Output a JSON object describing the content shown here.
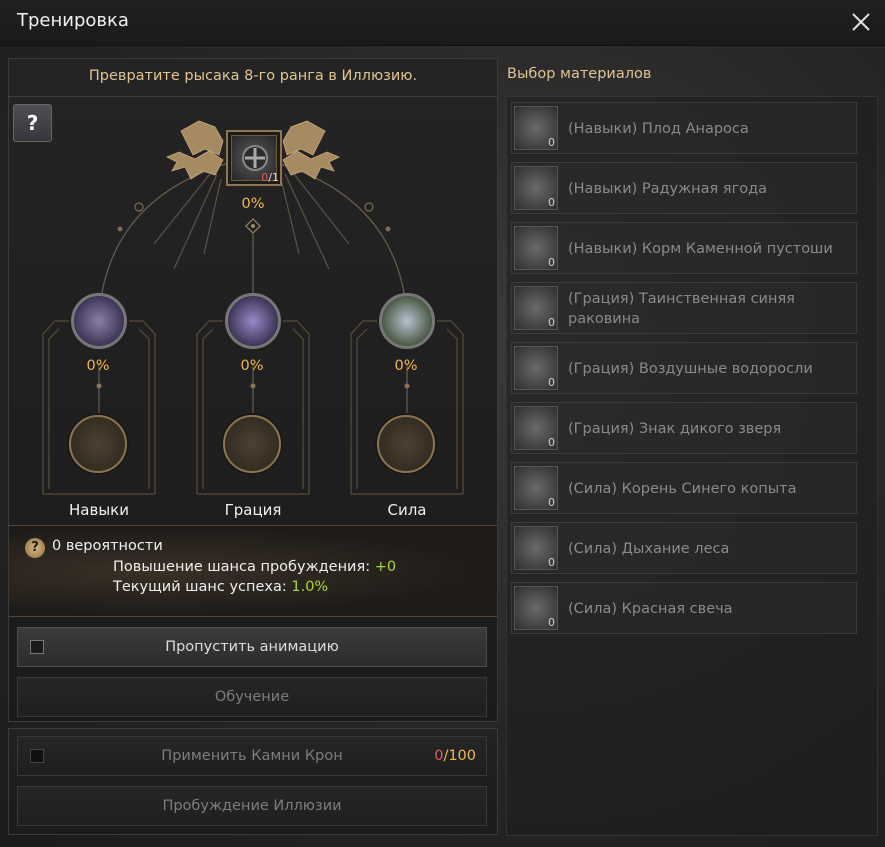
{
  "window": {
    "title": "Тренировка",
    "close_icon": "close-icon"
  },
  "left": {
    "header": "Превратите рысака 8-го ранга в Иллюзию.",
    "help_label": "?",
    "top_slot": {
      "count_current": "0",
      "count_total": "/1"
    },
    "top_percent": "0%",
    "columns": [
      {
        "percent": "0%",
        "label": "Навыки"
      },
      {
        "percent": "0%",
        "label": "Грация"
      },
      {
        "percent": "0%",
        "label": "Сила"
      }
    ],
    "probability": {
      "title": "0 вероятности",
      "awakening_label": "Повышение шанса пробуждения: ",
      "awakening_value": "+0",
      "success_label": "Текущий шанс успеха: ",
      "success_value": "1.0%"
    },
    "skip_animation": "Пропустить анимацию",
    "training_button": "Обучение",
    "crown_stones": {
      "label": "Применить Камни Крон",
      "current": "0",
      "total": "/100"
    },
    "awaken_button": "Пробуждение Иллюзии"
  },
  "materials": {
    "title": "Выбор материалов",
    "items": [
      {
        "label": "(Навыки) Плод Анароса",
        "count": "0"
      },
      {
        "label": "(Навыки) Радужная ягода",
        "count": "0"
      },
      {
        "label": "(Навыки) Корм Каменной пустоши",
        "count": "0"
      },
      {
        "label": "(Грация) Таинственная синяя раковина",
        "count": "0"
      },
      {
        "label": "(Грация) Воздушные водоросли",
        "count": "0"
      },
      {
        "label": "(Грация) Знак дикого зверя",
        "count": "0"
      },
      {
        "label": "(Сила) Корень Синего копыта",
        "count": "0"
      },
      {
        "label": "(Сила) Дыхание леса",
        "count": "0"
      },
      {
        "label": "(Сила) Красная свеча",
        "count": "0"
      }
    ]
  },
  "colors": {
    "gold": "#f2b84b",
    "accent": "#e0c494",
    "green": "#a6d935",
    "red": "#e06060"
  }
}
